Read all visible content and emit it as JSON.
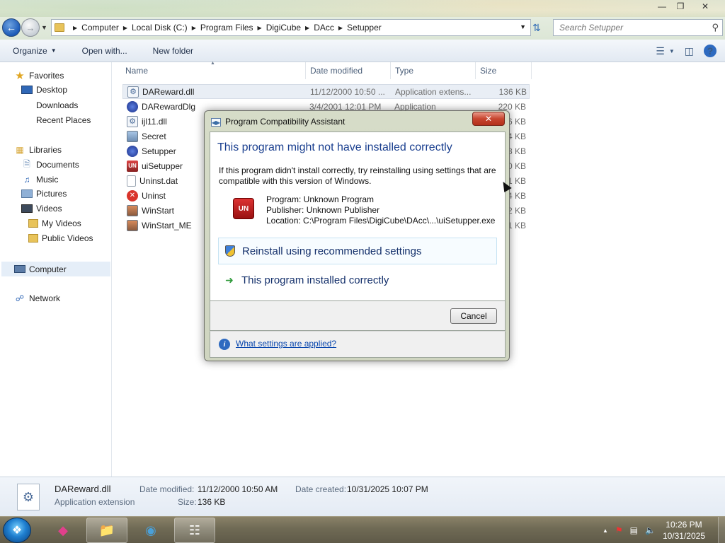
{
  "window": {
    "minimize": "—",
    "maximize": "❐",
    "close": "✕"
  },
  "address": {
    "crumbs": [
      "Computer",
      "Local Disk (C:)",
      "Program Files",
      "DigiCube",
      "DAcc",
      "Setupper"
    ]
  },
  "search": {
    "placeholder": "Search Setupper"
  },
  "toolbar": {
    "organize": "Organize",
    "open_with": "Open with...",
    "new_folder": "New folder"
  },
  "navpane": {
    "favorites": "Favorites",
    "desktop": "Desktop",
    "downloads": "Downloads",
    "recent_places": "Recent Places",
    "libraries": "Libraries",
    "documents": "Documents",
    "music": "Music",
    "pictures": "Pictures",
    "videos": "Videos",
    "my_videos": "My Videos",
    "public_videos": "Public Videos",
    "computer": "Computer",
    "network": "Network"
  },
  "columns": {
    "name": "Name",
    "date": "Date modified",
    "type": "Type",
    "size": "Size"
  },
  "files": [
    {
      "name": "DAReward.dll",
      "date": "11/12/2000 10:50 ...",
      "type": "Application extens...",
      "size": "136 KB",
      "icon": "dll-icon"
    },
    {
      "name": "DARewardDlg",
      "date": "3/4/2001 12:01 PM",
      "type": "Application",
      "size": "220 KB",
      "icon": "app-globe-icon"
    },
    {
      "name": "ijl11.dll",
      "date": "",
      "type": "",
      "size": "6 KB",
      "icon": "dll-icon"
    },
    {
      "name": "Secret",
      "date": "",
      "type": "",
      "size": "4 KB",
      "icon": "image-icon"
    },
    {
      "name": "Setupper",
      "date": "",
      "type": "",
      "size": "8 KB",
      "icon": "app-globe-icon"
    },
    {
      "name": "uiSetupper",
      "date": "",
      "type": "",
      "size": "0 KB",
      "icon": "installer-icon"
    },
    {
      "name": "Uninst.dat",
      "date": "",
      "type": "",
      "size": "1 KB",
      "icon": "blank-file-icon"
    },
    {
      "name": "Uninst",
      "date": "",
      "type": "",
      "size": "4 KB",
      "icon": "uninstall-icon"
    },
    {
      "name": "WinStart",
      "date": "",
      "type": "",
      "size": "2 KB",
      "icon": "image-icon"
    },
    {
      "name": "WinStart_ME",
      "date": "",
      "type": "",
      "size": "1 KB",
      "icon": "image-icon"
    }
  ],
  "details": {
    "name": "DAReward.dll",
    "kind": "Application extension",
    "date_modified_label": "Date modified:",
    "date_modified": "11/12/2000 10:50 AM",
    "date_created_label": "Date created:",
    "date_created": "10/31/2025 10:07 PM",
    "size_label": "Size:",
    "size": "136 KB"
  },
  "dialog": {
    "title": "Program Compatibility Assistant",
    "heading": "This program might not have installed correctly",
    "message": "If this program didn't install correctly, try reinstalling using settings that are compatible with this version of Windows.",
    "program": "Program: Unknown Program",
    "publisher": "Publisher: Unknown Publisher",
    "location": "Location: C:\\Program Files\\DigiCube\\DAcc\\...\\uiSetupper.exe",
    "option_reinstall": "Reinstall using recommended settings",
    "option_correct": "This program installed correctly",
    "cancel": "Cancel",
    "settings_link": "What settings are applied?"
  },
  "taskbar": {
    "time": "10:26 PM",
    "date": "10/31/2025"
  }
}
